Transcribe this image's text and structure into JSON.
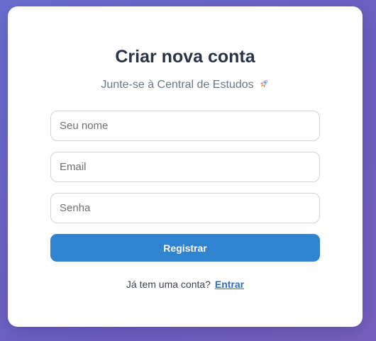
{
  "form": {
    "title": "Criar nova conta",
    "subtitle": "Junte-se à Central de Estudos",
    "subtitle_icon": "rocket-icon",
    "name_placeholder": "Seu nome",
    "email_placeholder": "Email",
    "password_placeholder": "Senha",
    "submit_label": "Registrar",
    "login_prompt": "Já tem uma conta?",
    "login_link": "Entrar"
  },
  "colors": {
    "background_gradient": [
      "#6a6fd1",
      "#7660bd"
    ],
    "accent": "#2f83cf",
    "title": "#2a3445",
    "link": "#2f6fb8"
  }
}
